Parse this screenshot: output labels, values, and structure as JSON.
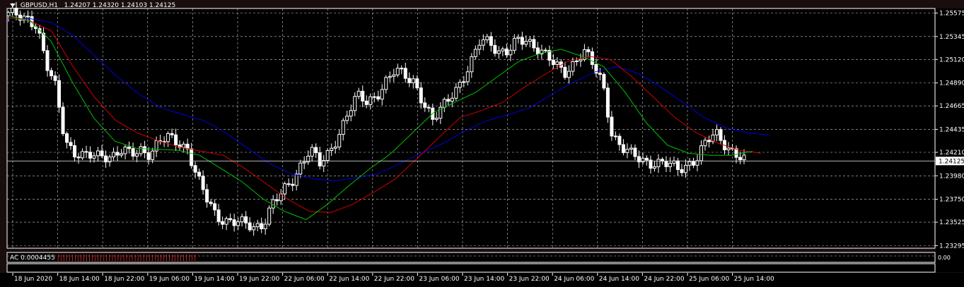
{
  "header": {
    "symbol": "GBPUSD,H1",
    "open": "1.24207",
    "high": "1.24320",
    "low": "1.24103",
    "close": "1.24125"
  },
  "indicator": {
    "label": "AC 0.0004455",
    "scale_label": "0.00"
  },
  "current_price": "1.24125",
  "colors": {
    "background": "#000000",
    "grid": "#c8c8c8",
    "candle": "#ffffff",
    "ma_fast": "#00c000",
    "ma_mid": "#d00000",
    "ma_slow": "#0000e0"
  },
  "chart_data": {
    "type": "candlestick",
    "title": "GBPUSD,H1",
    "y_ticks": [
      "1.25575",
      "1.25345",
      "1.25120",
      "1.24890",
      "1.24665",
      "1.24435",
      "1.24210",
      "1.23980",
      "1.23750",
      "1.23525",
      "1.23295"
    ],
    "x_ticks": [
      "18 Jun 2020",
      "18 Jun 14:00",
      "18 Jun 22:00",
      "19 Jun 06:00",
      "19 Jun 14:00",
      "19 Jun 22:00",
      "22 Jun 06:00",
      "22 Jun 14:00",
      "22 Jun 22:00",
      "23 Jun 06:00",
      "23 Jun 14:00",
      "23 Jun 22:00",
      "24 Jun 06:00",
      "24 Jun 14:00",
      "24 Jun 22:00",
      "25 Jun 06:00",
      "25 Jun 14:00"
    ],
    "ylim": [
      1.2327,
      1.2562
    ],
    "grid": true,
    "close_anchors": [
      1.2555,
      1.2556,
      1.2554,
      1.2545,
      1.2505,
      1.2485,
      1.2435,
      1.242,
      1.2415,
      1.2418,
      1.242,
      1.2417,
      1.2421,
      1.2419,
      1.2425,
      1.242,
      1.243,
      1.2435,
      1.2432,
      1.2425,
      1.2395,
      1.2375,
      1.236,
      1.2355,
      1.2352,
      1.235,
      1.2348,
      1.2352,
      1.237,
      1.238,
      1.2392,
      1.241,
      1.2425,
      1.2408,
      1.242,
      1.244,
      1.246,
      1.2475,
      1.247,
      1.2478,
      1.249,
      1.25,
      1.2496,
      1.2492,
      1.247,
      1.245,
      1.2465,
      1.248,
      1.249,
      1.2505,
      1.253,
      1.2532,
      1.252,
      1.2518,
      1.253,
      1.2532,
      1.2525,
      1.2515,
      1.2505,
      1.25,
      1.251,
      1.252,
      1.2505,
      1.249,
      1.244,
      1.2425,
      1.2418,
      1.2415,
      1.2412,
      1.241,
      1.2408,
      1.2405,
      1.241,
      1.2415,
      1.243,
      1.244,
      1.243,
      1.242,
      1.2412
    ],
    "ma_fast_anchors": [
      1.2555,
      1.255,
      1.253,
      1.249,
      1.2455,
      1.2432,
      1.2425,
      1.2424,
      1.2423,
      1.2418,
      1.2405,
      1.2392,
      1.2375,
      1.2363,
      1.2355,
      1.237,
      1.2388,
      1.2405,
      1.242,
      1.244,
      1.246,
      1.247,
      1.248,
      1.2495,
      1.251,
      1.2518,
      1.2522,
      1.2515,
      1.2505,
      1.248,
      1.245,
      1.2428,
      1.242,
      1.2418,
      1.2418,
      1.2422
    ],
    "ma_mid_anchors": [
      1.2553,
      1.255,
      1.254,
      1.2505,
      1.2475,
      1.2452,
      1.244,
      1.2432,
      1.2426,
      1.2422,
      1.2418,
      1.2405,
      1.239,
      1.2375,
      1.2363,
      1.2362,
      1.237,
      1.2382,
      1.2395,
      1.2415,
      1.2435,
      1.2455,
      1.2462,
      1.247,
      1.2485,
      1.2498,
      1.251,
      1.2515,
      1.2512,
      1.2495,
      1.2475,
      1.2455,
      1.244,
      1.243,
      1.2423,
      1.242
    ],
    "ma_slow_anchors": [
      1.2552,
      1.2552,
      1.2548,
      1.2535,
      1.2515,
      1.2495,
      1.2478,
      1.2465,
      1.2458,
      1.2452,
      1.244,
      1.2425,
      1.241,
      1.24,
      1.2395,
      1.2393,
      1.2396,
      1.24,
      1.241,
      1.242,
      1.243,
      1.2442,
      1.2452,
      1.2458,
      1.2465,
      1.2478,
      1.249,
      1.25,
      1.2505,
      1.2498,
      1.2485,
      1.247,
      1.2455,
      1.2445,
      1.244,
      1.2438
    ]
  }
}
